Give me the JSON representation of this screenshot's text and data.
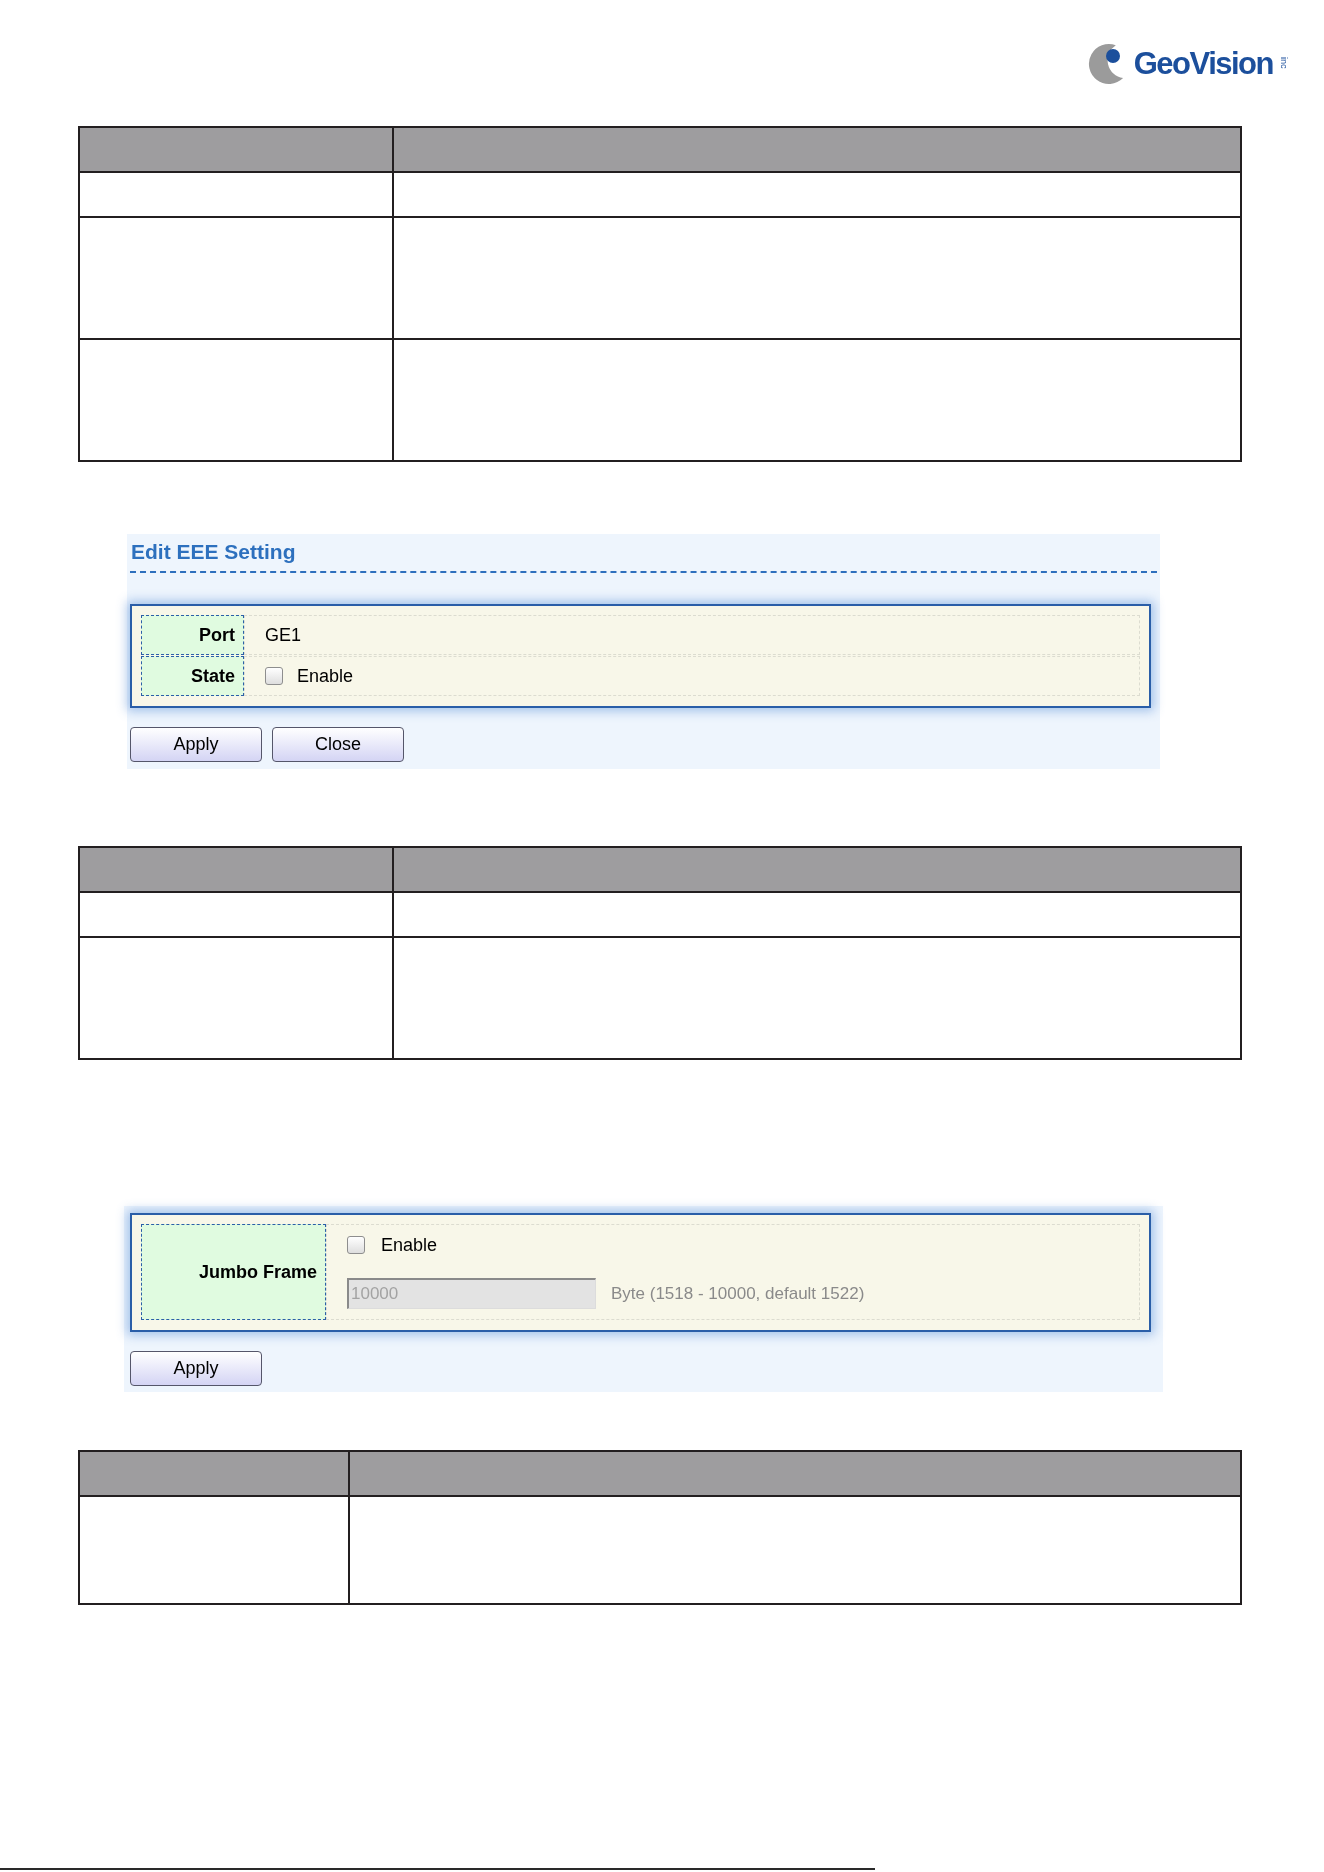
{
  "logo": {
    "name": "GeoVision",
    "suffix": "inc"
  },
  "sections": [
    {
      "kind": "wide_label_table",
      "rows": [
        {
          "kind": "single_line"
        },
        {
          "kind": "three_line"
        },
        {
          "kind": "three_line"
        }
      ]
    },
    {
      "kind": "form_panel",
      "title": "Edit EEE Setting",
      "fields": [
        {
          "kind": "text",
          "label": "Port",
          "value": "GE1"
        },
        {
          "kind": "checkbox",
          "label": "State",
          "option": "Enable",
          "checked": false
        }
      ],
      "buttons": [
        "Apply",
        "Close"
      ]
    },
    {
      "kind": "wide_label_table",
      "rows": [
        {
          "kind": "single_line"
        },
        {
          "kind": "three_line"
        }
      ]
    },
    {
      "kind": "form_panel",
      "fields": [
        {
          "kind": "checkbox_with_input",
          "label": "Jumbo Frame",
          "option": "Enable",
          "checked": false,
          "input": {
            "value": "10000",
            "disabled": true
          },
          "hint": "Byte (1518 - 10000, default 1522)"
        }
      ],
      "buttons": [
        "Apply"
      ]
    },
    {
      "kind": "narrow_label_table",
      "rows": [
        {
          "kind": "two_line"
        }
      ]
    }
  ]
}
